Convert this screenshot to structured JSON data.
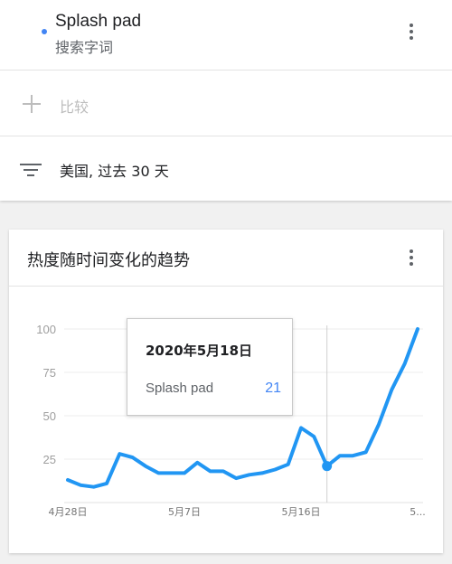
{
  "search_term": {
    "name": "Splash pad",
    "type": "搜索字词",
    "color": "#4285f4"
  },
  "compare": {
    "label": "比较"
  },
  "filter": {
    "label": "美国, 过去 30 天"
  },
  "chart_card": {
    "title": "热度随时间变化的趋势"
  },
  "tooltip": {
    "date": "2020年5月18日",
    "series": "Splash pad",
    "value": "21"
  },
  "chart_data": {
    "type": "line",
    "title": "",
    "xlabel": "",
    "ylabel": "",
    "ylim": [
      0,
      100
    ],
    "yticks": [
      25,
      50,
      75,
      100
    ],
    "grid": true,
    "x_tick_labels": [
      {
        "index": 0,
        "label": "4月28日"
      },
      {
        "index": 9,
        "label": "5月7日"
      },
      {
        "index": 18,
        "label": "5月16日"
      },
      {
        "index": 28,
        "label": "5..."
      }
    ],
    "highlight_index": 20,
    "line_color": "#2196f3",
    "series": [
      {
        "name": "Splash pad",
        "values": [
          13,
          10,
          9,
          11,
          28,
          26,
          21,
          17,
          17,
          17,
          23,
          18,
          18,
          14,
          16,
          17,
          19,
          22,
          43,
          38,
          21,
          27,
          27,
          29,
          45,
          65,
          80,
          100
        ]
      }
    ]
  }
}
